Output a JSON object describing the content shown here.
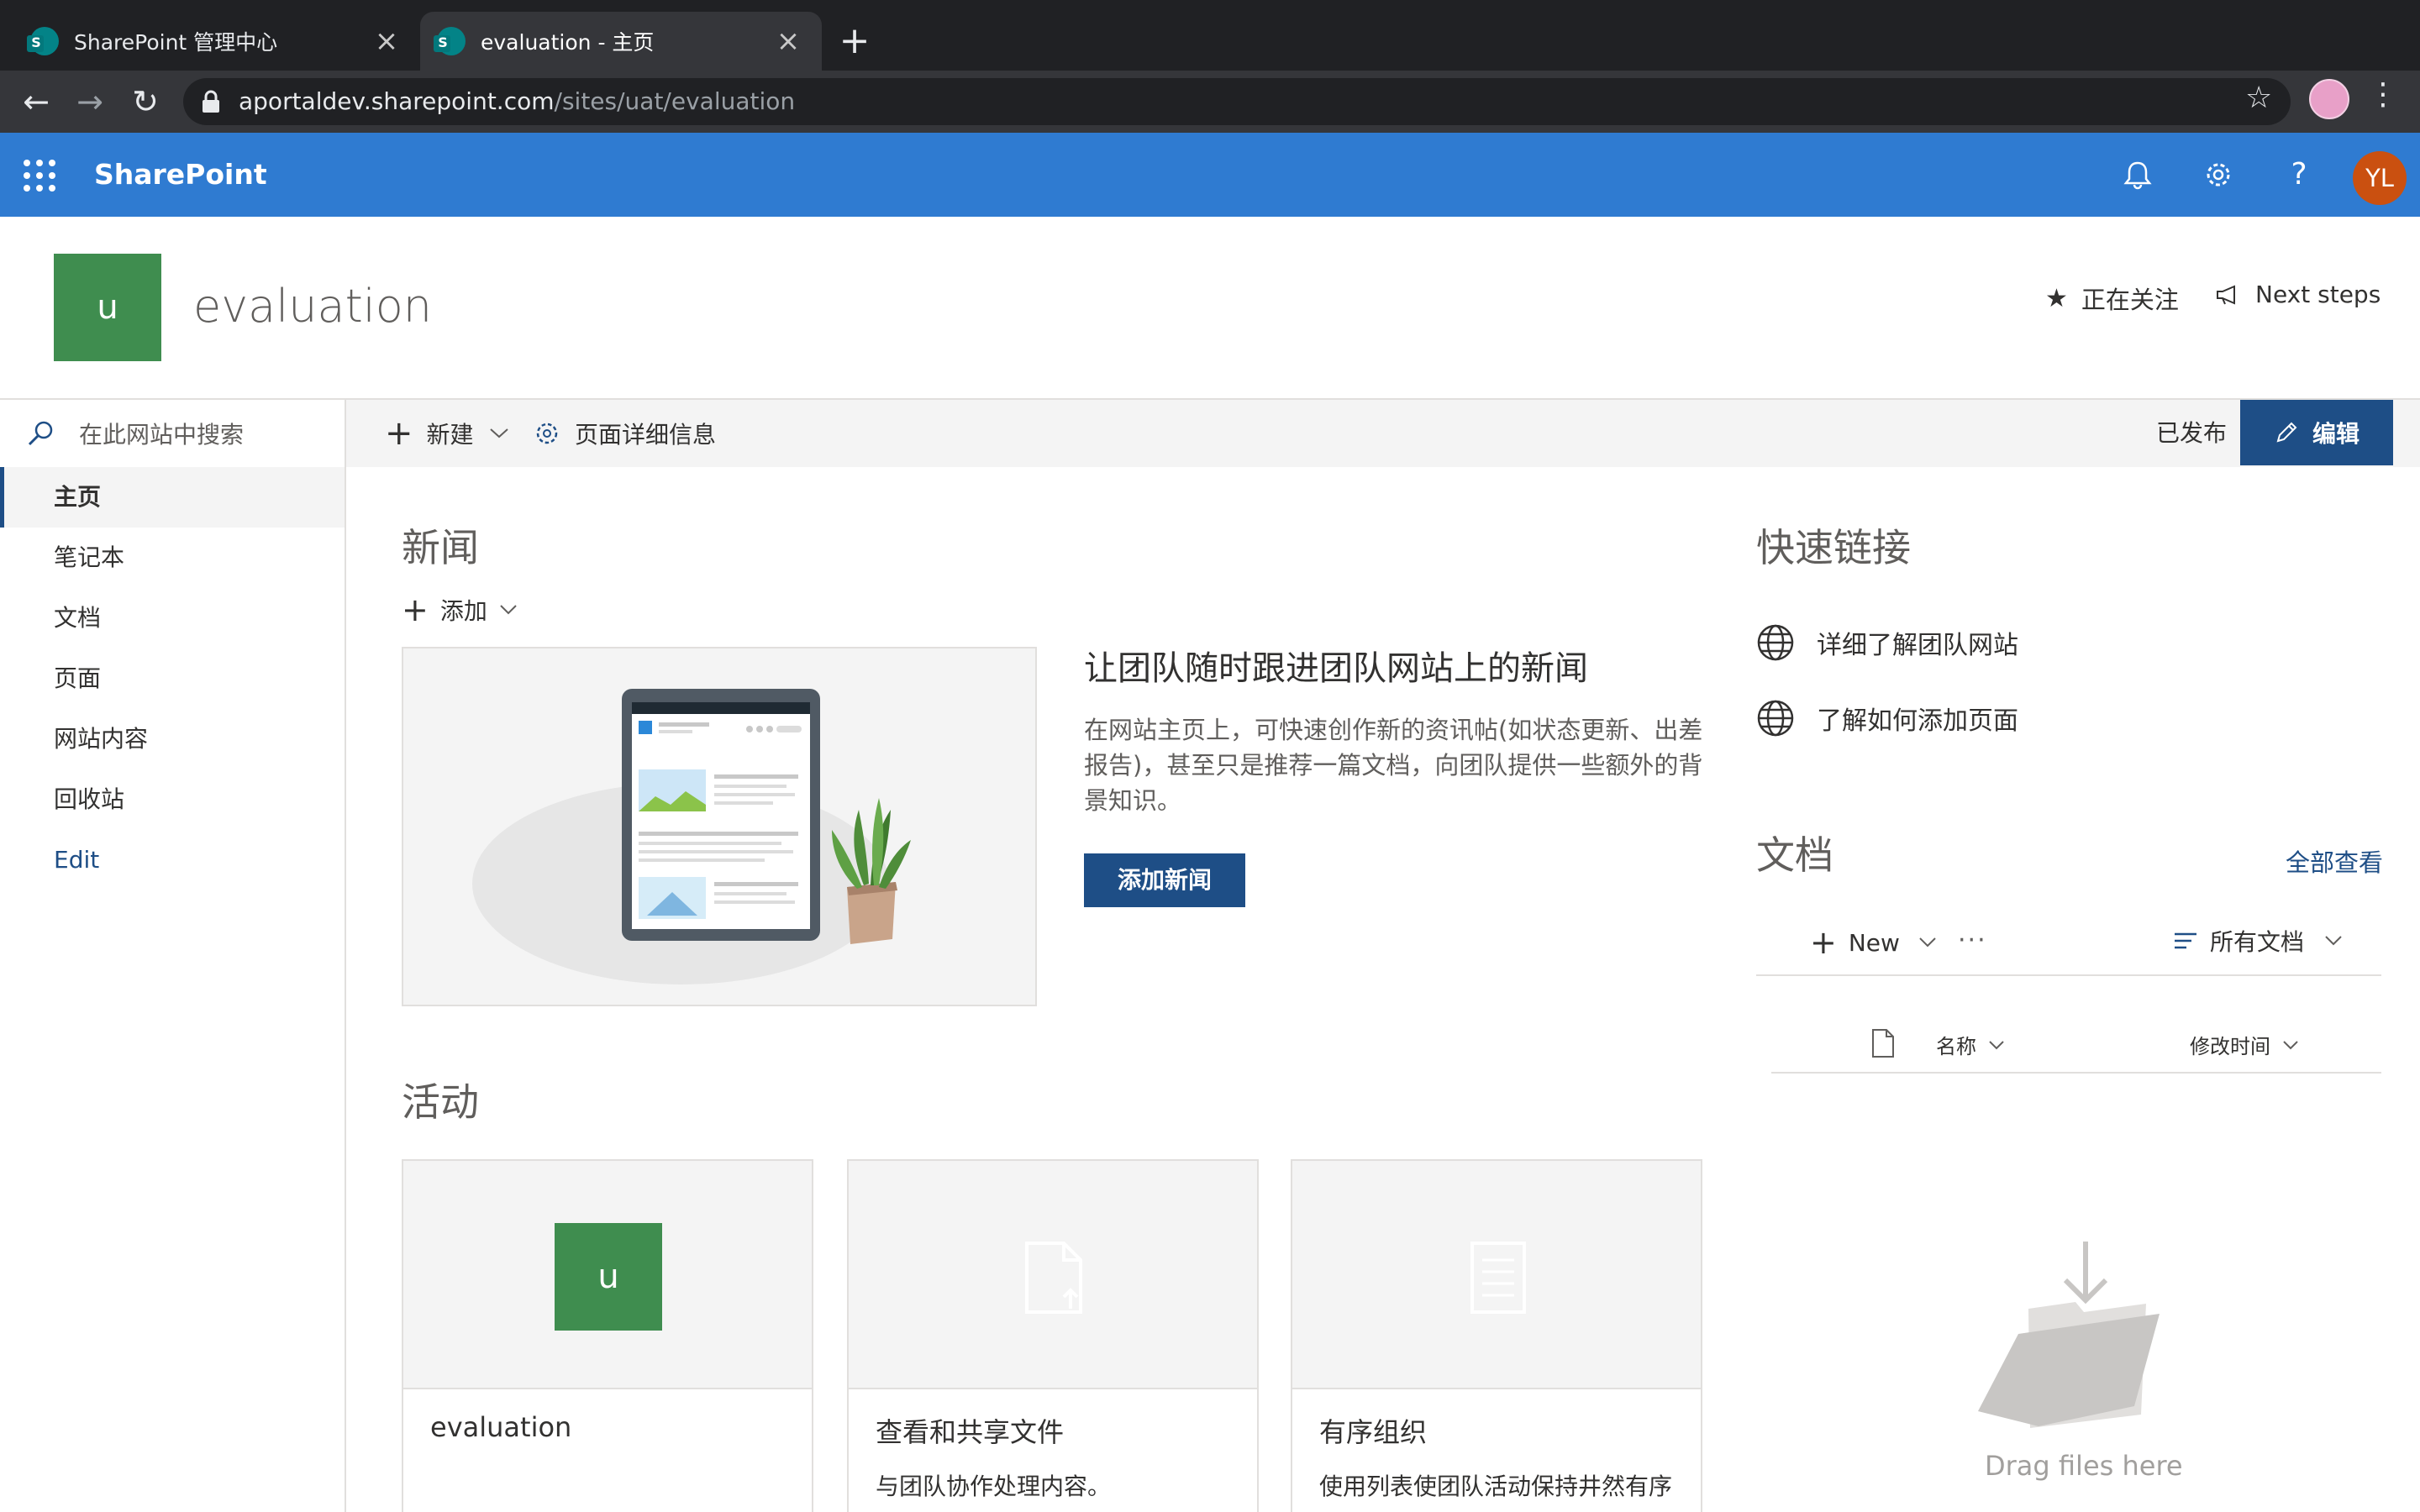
{
  "browser": {
    "tabs": [
      {
        "title": "SharePoint 管理中心",
        "active": false
      },
      {
        "title": "evaluation - 主页",
        "active": true
      }
    ],
    "url_host": "aportaldev.sharepoint.com",
    "url_path": "/sites/uat/evaluation"
  },
  "suite": {
    "brand": "SharePoint",
    "avatar_initials": "YL",
    "colors": {
      "suite_bar": "#2f7bd1",
      "theme": "#1e4e86",
      "avatar": "#ca5010"
    }
  },
  "site": {
    "logo_letter": "u",
    "logo_color": "#3f8d4f",
    "title": "evaluation",
    "follow_label": "正在关注",
    "next_steps_label": "Next steps"
  },
  "search": {
    "placeholder": "在此网站中搜索"
  },
  "commandbar": {
    "new_label": "新建",
    "page_details_label": "页面详细信息",
    "status_label": "已发布",
    "edit_label": "编辑"
  },
  "nav": {
    "items": [
      {
        "label": "主页",
        "selected": true
      },
      {
        "label": "笔记本"
      },
      {
        "label": "文档"
      },
      {
        "label": "页面"
      },
      {
        "label": "网站内容"
      },
      {
        "label": "回收站"
      },
      {
        "label": "Edit",
        "link": true
      }
    ]
  },
  "news": {
    "title": "新闻",
    "add_label": "添加",
    "heading": "让团队随时跟进团队网站上的新闻",
    "body": "在网站主页上，可快速创作新的资讯帖(如状态更新、出差报告)，甚至只是推荐一篇文档，向团队提供一些额外的背景知识。",
    "button_label": "添加新闻"
  },
  "activity": {
    "title": "活动",
    "cards": [
      {
        "title": "evaluation",
        "desc": ""
      },
      {
        "title": "查看和共享文件",
        "desc": "与团队协作处理内容。"
      },
      {
        "title": "有序组织",
        "desc": "使用列表使团队活动保持井然有序"
      }
    ]
  },
  "quick_links": {
    "title": "快速链接",
    "items": [
      {
        "label": "详细了解团队网站",
        "icon": "globe-icon"
      },
      {
        "label": "了解如何添加页面",
        "icon": "globe-icon"
      }
    ]
  },
  "documents": {
    "title": "文档",
    "view_all_label": "全部查看",
    "new_label": "New",
    "more_label": "···",
    "view_label": "所有文档",
    "columns": {
      "name": "名称",
      "modified": "修改时间"
    },
    "empty_text": "Drag files here"
  }
}
